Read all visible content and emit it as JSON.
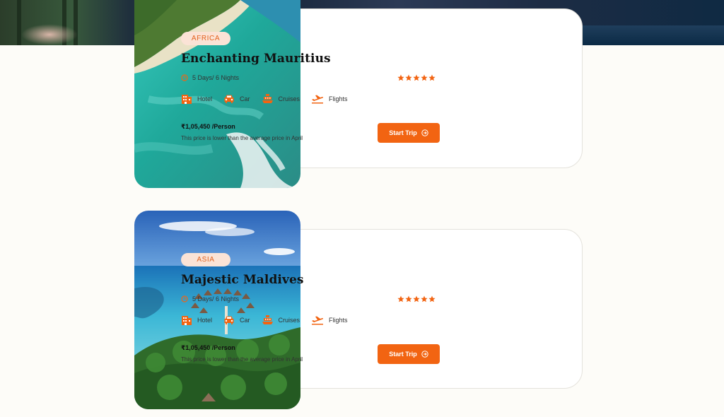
{
  "colors": {
    "accent": "#f26412",
    "badge_bg": "#fbe3d6",
    "badge_text": "#e3621e",
    "page_bg": "#fdfcf8"
  },
  "packages": [
    {
      "region": "AFRICA",
      "title": "Enchanting Mauritius",
      "duration": "5 Days/ 6 Nights",
      "rating": 5,
      "amenities": [
        {
          "label": "Hotel",
          "icon": "hotel-icon"
        },
        {
          "label": "Car",
          "icon": "car-icon"
        },
        {
          "label": "Cruises",
          "icon": "cruise-icon"
        },
        {
          "label": "Flights",
          "icon": "flight-icon"
        }
      ],
      "price": "₹1,05,450 /Person",
      "price_note": "This price is lower than the average price in April",
      "cta": "Start Trip"
    },
    {
      "region": "ASIA",
      "title": "Majestic Maldives",
      "duration": "5 Days/ 6 Nights",
      "rating": 5,
      "amenities": [
        {
          "label": "Hotel",
          "icon": "hotel-icon"
        },
        {
          "label": "Car",
          "icon": "car-icon"
        },
        {
          "label": "Cruises",
          "icon": "cruise-icon"
        },
        {
          "label": "Flights",
          "icon": "flight-icon"
        }
      ],
      "price": "₹1,05,450 /Person",
      "price_note": "This price is lower than the average price in April",
      "cta": "Start Trip"
    }
  ]
}
